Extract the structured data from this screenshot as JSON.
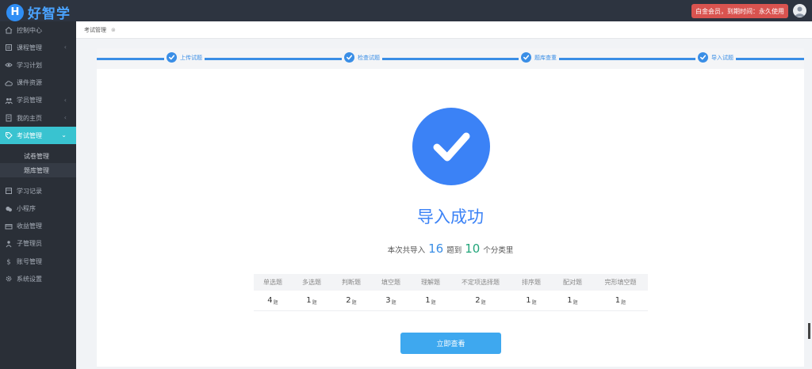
{
  "app": {
    "logo_letter": "H",
    "logo_text": "好智学"
  },
  "header": {
    "member_badge": "白金会员，到期时间：永久使用"
  },
  "sidebar": {
    "items": [
      {
        "label": "控制中心",
        "icon": "home-icon",
        "chevron": false
      },
      {
        "label": "课程管理",
        "icon": "book-icon",
        "chevron": true
      },
      {
        "label": "学习计划",
        "icon": "eye-icon",
        "chevron": false
      },
      {
        "label": "课件资源",
        "icon": "cloud-icon",
        "chevron": false
      },
      {
        "label": "学员管理",
        "icon": "users-icon",
        "chevron": true
      },
      {
        "label": "我的主页",
        "icon": "page-icon",
        "chevron": true
      },
      {
        "label": "考试管理",
        "icon": "tag-icon",
        "chevron": true,
        "active": true
      }
    ],
    "sub_items": [
      {
        "label": "试卷管理"
      },
      {
        "label": "题库管理",
        "selected": true
      }
    ],
    "items2": [
      {
        "label": "学习记录",
        "icon": "record-icon"
      },
      {
        "label": "小程序",
        "icon": "wechat-icon"
      },
      {
        "label": "收益管理",
        "icon": "card-icon"
      },
      {
        "label": "子管理员",
        "icon": "admin-icon"
      },
      {
        "label": "账号管理",
        "icon": "dollar-icon"
      },
      {
        "label": "系统设置",
        "icon": "gear-icon"
      }
    ],
    "chevron_glyph": "‹",
    "chevron_open_glyph": "⌄"
  },
  "breadcrumb": {
    "label": "考试管理",
    "close": "⊗"
  },
  "steps": [
    {
      "label": "上传试题"
    },
    {
      "label": "检查试题"
    },
    {
      "label": "题库查重"
    },
    {
      "label": "导入试题"
    }
  ],
  "result": {
    "title": "导入成功",
    "summary_prefix": "本次共导入",
    "question_count": "16",
    "summary_mid": "题到",
    "category_count": "10",
    "summary_suffix": "个分类里"
  },
  "table": {
    "headers": [
      "单选题",
      "多选题",
      "判断题",
      "填空题",
      "理解题",
      "不定项选择题",
      "排序题",
      "配对题",
      "完形填空题"
    ],
    "values": [
      "4",
      "1",
      "2",
      "3",
      "1",
      "2",
      "1",
      "1",
      "1"
    ],
    "unit": "题"
  },
  "buttons": {
    "view": "立即查看"
  },
  "colors": {
    "accent": "#3b82f6",
    "sidebar_active": "#39c3d0",
    "badge": "#d9534f",
    "button": "#3ea8ef",
    "count_green": "#22a57a"
  }
}
